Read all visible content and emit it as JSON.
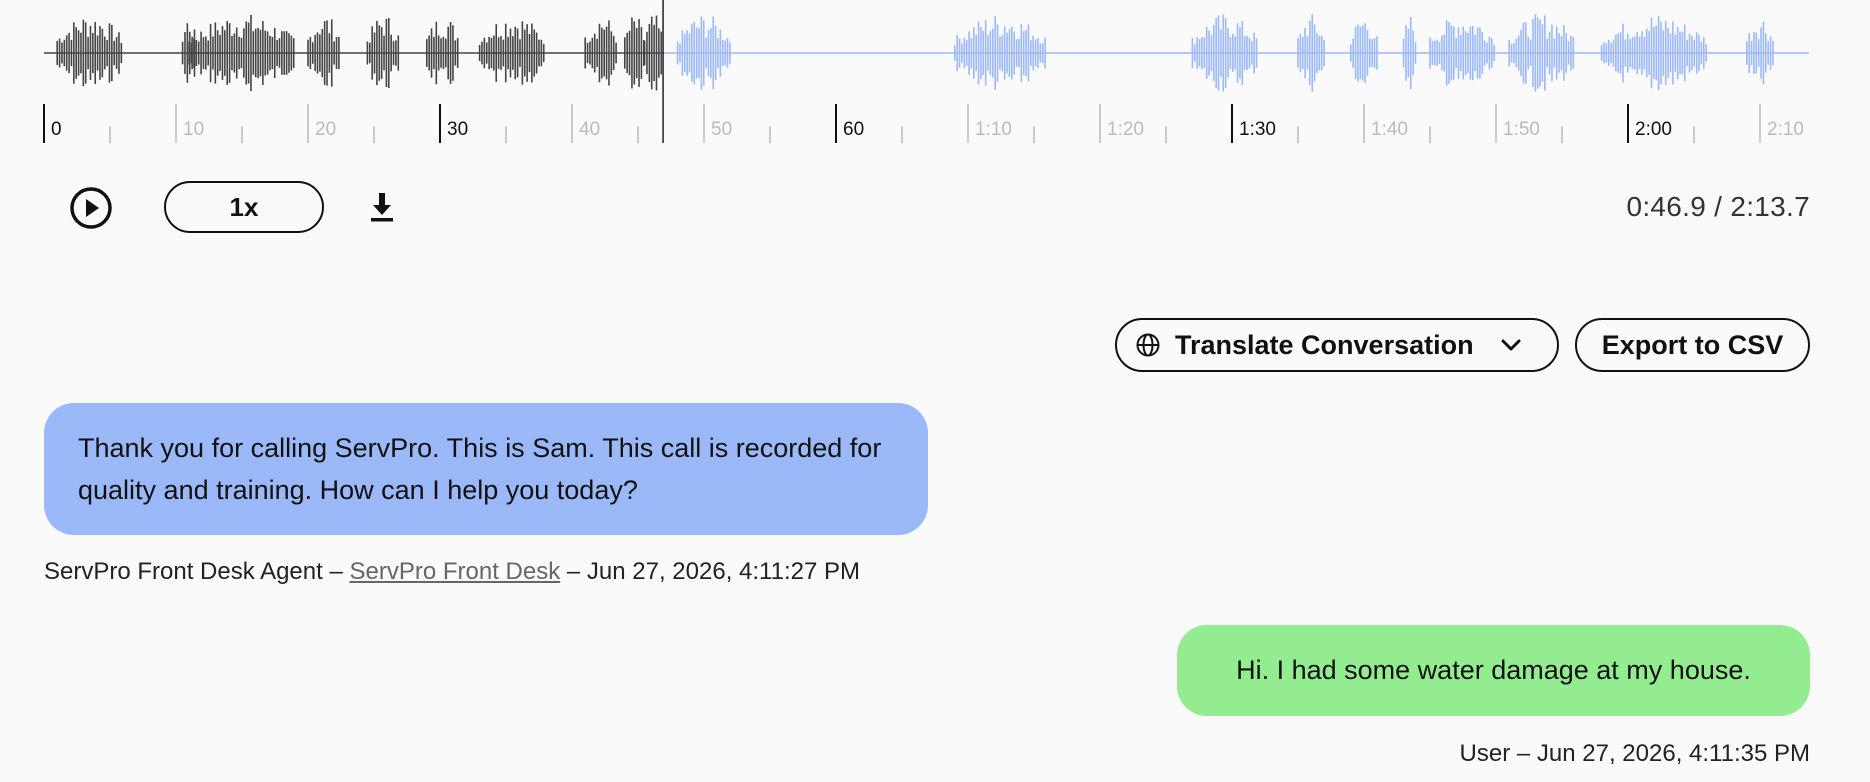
{
  "player": {
    "playhead_seconds": 46.9,
    "duration_seconds": 133.7,
    "played_color": "#444444",
    "unplayed_color": "#9bb8f8",
    "major_ticks": [
      "0",
      "30",
      "60",
      "1:30",
      "2:00"
    ],
    "minor_ticks": [
      "10",
      "20",
      "40",
      "50",
      "1:10",
      "1:20",
      "1:40",
      "1:50",
      "2:10"
    ],
    "speed_label": "1x",
    "time_readout": "0:46.9 / 2:13.7",
    "play_icon": "play-circle-icon",
    "download_icon": "download-icon"
  },
  "actions": {
    "translate_label": "Translate Conversation",
    "translate_icon": "globe-icon",
    "translate_chevron": "chevron-down-icon",
    "export_label": "Export to CSV"
  },
  "conversation": {
    "messages": [
      {
        "role": "agent",
        "text": "Thank you for calling ServPro. This is Sam. This call is recorded for quality and training. How can I help you today?",
        "sender": "ServPro Front Desk Agent",
        "sep1": " – ",
        "link": "ServPro Front Desk",
        "sep2": " – ",
        "timestamp": "Jun 27, 2026, 4:11:27 PM",
        "color": "#9bb8f8"
      },
      {
        "role": "user",
        "text": "Hi. I had some water damage at my house.",
        "sender": "User",
        "sep": " – ",
        "timestamp": "Jun 27, 2026, 4:11:35 PM",
        "color": "#94ec90"
      }
    ]
  }
}
